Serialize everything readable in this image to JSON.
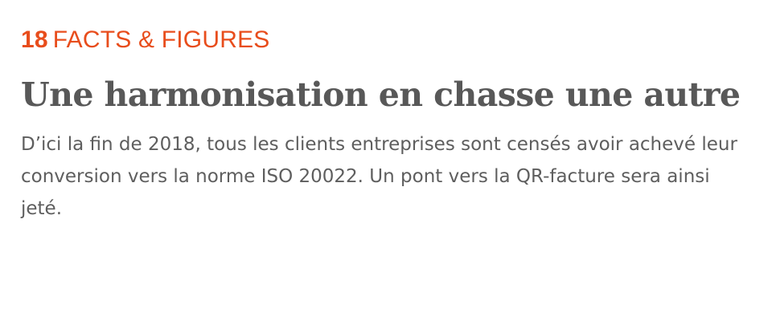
{
  "kicker": {
    "page_number": "18",
    "section": "FACTS & FIGURES"
  },
  "headline": "Une harmonisation en chasse une autre",
  "lead": "D’ici la fin de 2018, tous les clients entreprises sont censés avoir achevé leur conversion vers la norme ISO 20022. Un pont vers la QR-facture sera ainsi jeté.",
  "colors": {
    "accent": "#e84d1c",
    "headline": "#585858",
    "body": "#5e5e5e"
  }
}
